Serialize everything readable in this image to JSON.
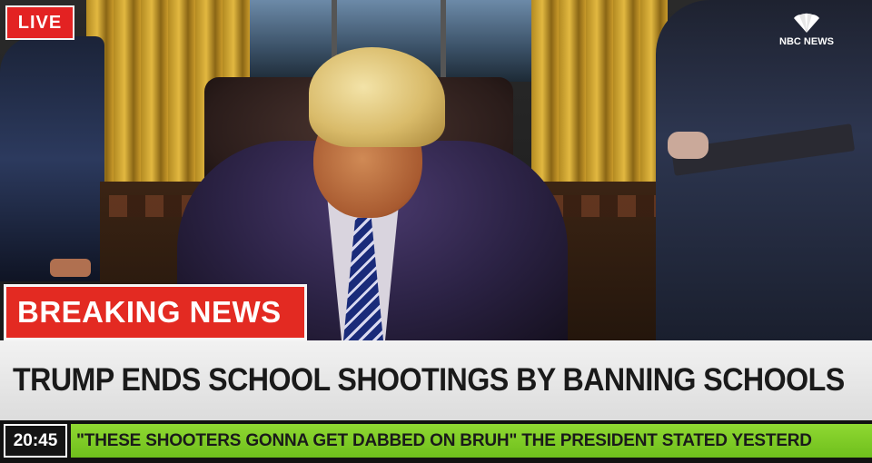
{
  "badges": {
    "live": "LIVE"
  },
  "network": {
    "name": "NBC NEWS",
    "logo_icon": "peacock-icon"
  },
  "banner": {
    "breaking": "BREAKING NEWS"
  },
  "headline": "TRUMP ENDS SCHOOL SHOOTINGS BY BANNING SCHOOLS",
  "ticker": {
    "time": "20:45",
    "text": "\"THESE SHOOTERS GONNA GET DABBED ON BRUH\" THE PRESIDENT STATED YESTERD"
  },
  "colors": {
    "breaking_red": "#e32a22",
    "headline_bg": "#f2f2f2",
    "ticker_green": "#7cc824"
  }
}
